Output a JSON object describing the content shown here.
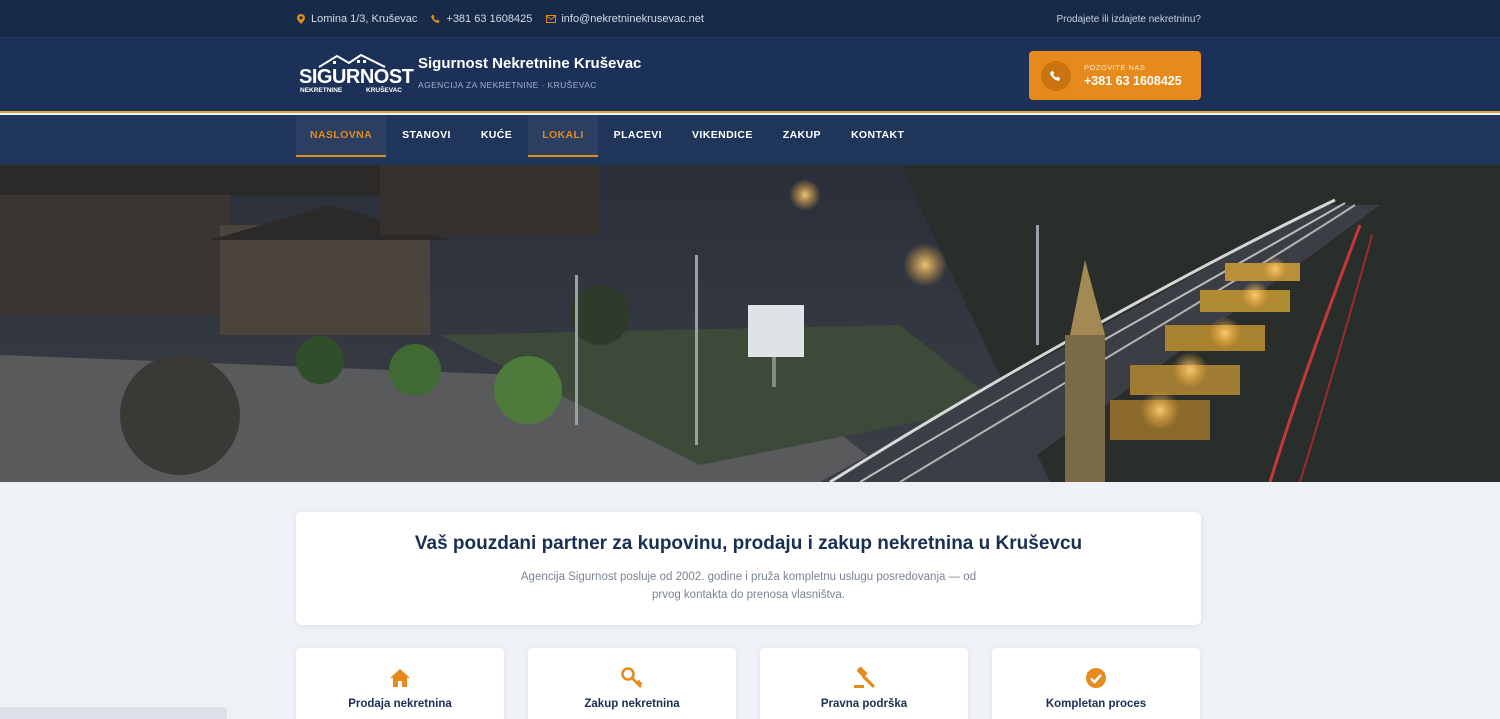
{
  "topbar": {
    "address": "Lomina 1/3, Kruševac",
    "phone": "+381 63 1608425",
    "email": "info@nekretninekrusevac.net",
    "right_link": "Prodajete ili izdajete nekretninu?",
    "icons": [
      "map-pin-icon",
      "phone-icon",
      "envelope-icon"
    ]
  },
  "header": {
    "logo_big": "SIGURNOST",
    "logo_small_left": "NEKRETNINE",
    "logo_small_right": "KRUŠEVAC",
    "title": "Sigurnost Nekretnine Kruševac",
    "subtitle": "AGENCIJA ZA NEKRETNINE · KRUŠEVAC",
    "cta_label": "POZOVITE NAS",
    "cta_number": "+381 63 1608425"
  },
  "nav": {
    "items": [
      {
        "label": "NASLOVNA",
        "state": "active"
      },
      {
        "label": "STANOVI",
        "state": ""
      },
      {
        "label": "KUĆE",
        "state": ""
      },
      {
        "label": "LOKALI",
        "state": "highlight"
      },
      {
        "label": "PLACEVI",
        "state": ""
      },
      {
        "label": "VIKENDICE",
        "state": ""
      },
      {
        "label": "ZAKUP",
        "state": ""
      },
      {
        "label": "KONTAKT",
        "state": ""
      }
    ]
  },
  "intro": {
    "heading": "Vaš pouzdani partner za kupovinu, prodaju i zakup nekretnina u Kruševcu",
    "text": "Agencija Sigurnost posluje od 2002. godine i pruža kompletnu uslugu posredovanja — od prvog kontakta do prenosa vlasništva."
  },
  "services": [
    {
      "title": "Prodaja nekretnina",
      "icon": "home-icon"
    },
    {
      "title": "Zakup nekretnina",
      "icon": "key-icon"
    },
    {
      "title": "Pravna podrška",
      "icon": "gavel-icon"
    },
    {
      "title": "Kompletan proces",
      "icon": "check-circle-icon"
    }
  ],
  "colors": {
    "topbar": "#172a47",
    "header": "#1b3158",
    "nav": "#1f3559",
    "accent": "#e58a1b",
    "heading": "#1b2f52"
  }
}
